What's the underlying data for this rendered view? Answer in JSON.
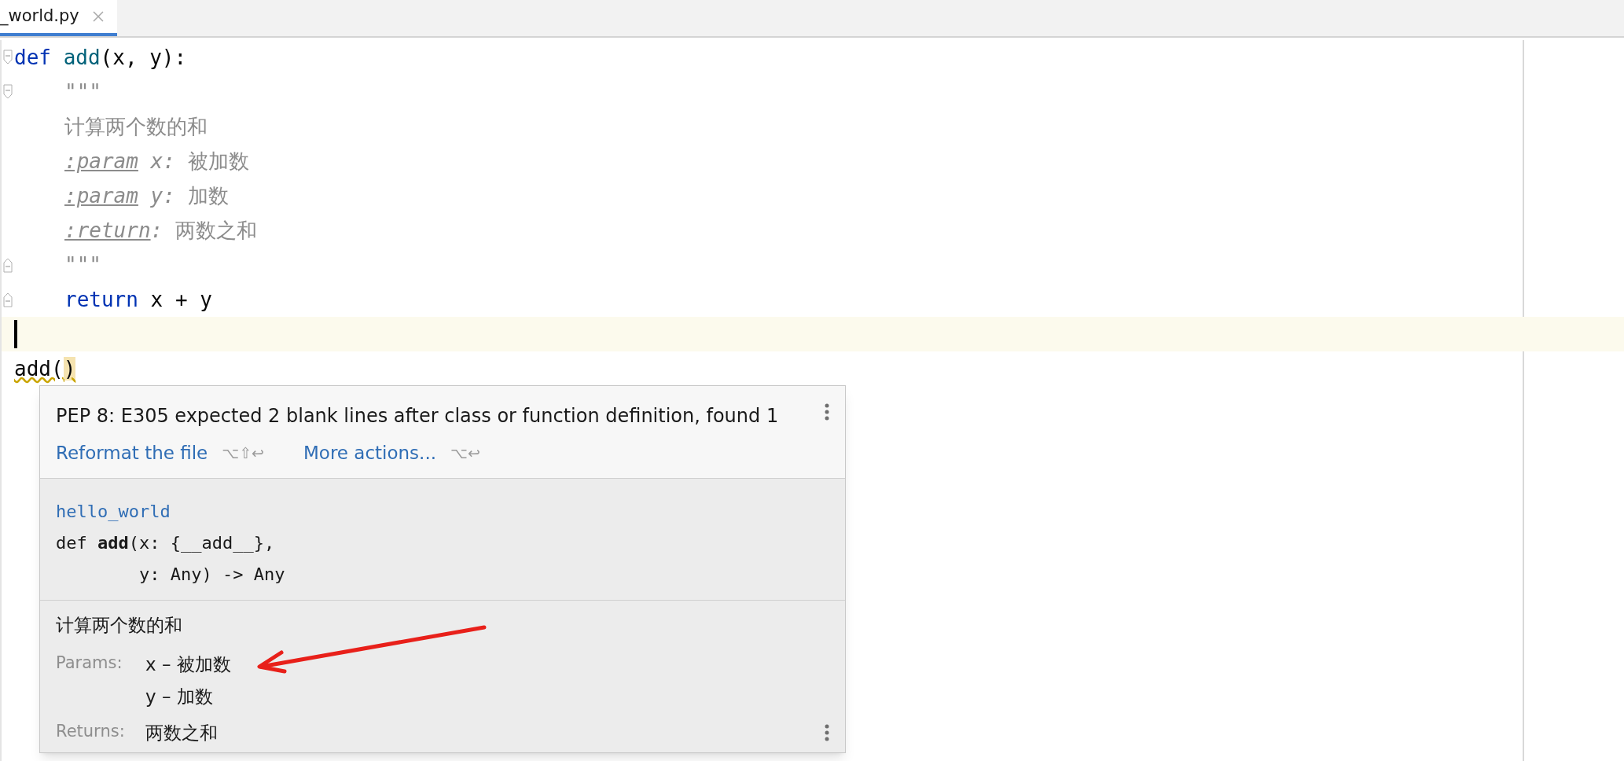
{
  "tab": {
    "label": "_world.py",
    "selected": true
  },
  "editor": {
    "lines": [
      {
        "fold_open": true,
        "fold_close": false,
        "indented": false,
        "current": false,
        "caret": false,
        "tokens": [
          {
            "kind": "keyword",
            "text": "def "
          },
          {
            "kind": "function",
            "text": "add"
          },
          {
            "kind": "plain",
            "text": "(x, y):"
          }
        ]
      },
      {
        "fold_open": true,
        "fold_close": false,
        "indented": true,
        "current": false,
        "caret": false,
        "tokens": [
          {
            "kind": "docstring",
            "text": "\"\"\""
          }
        ]
      },
      {
        "fold_open": false,
        "fold_close": false,
        "indented": true,
        "current": false,
        "caret": false,
        "tokens": [
          {
            "kind": "docstring",
            "text": "计算两个数的和"
          }
        ]
      },
      {
        "fold_open": false,
        "fold_close": false,
        "indented": true,
        "current": false,
        "caret": false,
        "tokens": [
          {
            "kind": "doc_tag",
            "text": ":param"
          },
          {
            "kind": "doc_param",
            "text": " x:"
          },
          {
            "kind": "docstring",
            "text": " 被加数"
          }
        ]
      },
      {
        "fold_open": false,
        "fold_close": false,
        "indented": true,
        "current": false,
        "caret": false,
        "tokens": [
          {
            "kind": "doc_tag",
            "text": ":param"
          },
          {
            "kind": "doc_param",
            "text": " y:"
          },
          {
            "kind": "docstring",
            "text": " 加数"
          }
        ]
      },
      {
        "fold_open": false,
        "fold_close": false,
        "indented": true,
        "current": false,
        "caret": false,
        "tokens": [
          {
            "kind": "doc_tag",
            "text": ":return"
          },
          {
            "kind": "doc_param",
            "text": ":"
          },
          {
            "kind": "docstring",
            "text": " 两数之和"
          }
        ]
      },
      {
        "fold_open": false,
        "fold_close": true,
        "indented": true,
        "current": false,
        "caret": false,
        "tokens": [
          {
            "kind": "docstring",
            "text": "\"\"\""
          }
        ]
      },
      {
        "fold_open": false,
        "fold_close": true,
        "indented": true,
        "current": false,
        "caret": false,
        "tokens": [
          {
            "kind": "keyword",
            "text": "return"
          },
          {
            "kind": "plain",
            "text": " x + y"
          }
        ]
      },
      {
        "fold_open": false,
        "fold_close": false,
        "indented": false,
        "current": true,
        "caret": true
      },
      {
        "fold_open": false,
        "fold_close": false,
        "indented": false,
        "current": false,
        "caret": false,
        "tokens": [
          {
            "kind": "warning",
            "text": "add("
          },
          {
            "kind": "brace_match",
            "text": ")"
          }
        ]
      }
    ]
  },
  "popup": {
    "problem": {
      "message": "PEP 8: E305 expected 2 blank lines after class or function definition, found 1",
      "actions": [
        {
          "label": "Reformat the file",
          "shortcut": "⌥⇧↩"
        },
        {
          "label": "More actions...",
          "shortcut": "⌥↩"
        }
      ]
    },
    "doc": {
      "module": "hello_world",
      "signature": [
        "def **add**(x: {__add__},",
        "        y: Any) -> Any"
      ],
      "description": "计算两个数的和",
      "params_label": "Params:",
      "params": [
        "x – 被加数",
        "y – 加数"
      ],
      "returns_label": "Returns:",
      "returns": "两数之和"
    }
  }
}
